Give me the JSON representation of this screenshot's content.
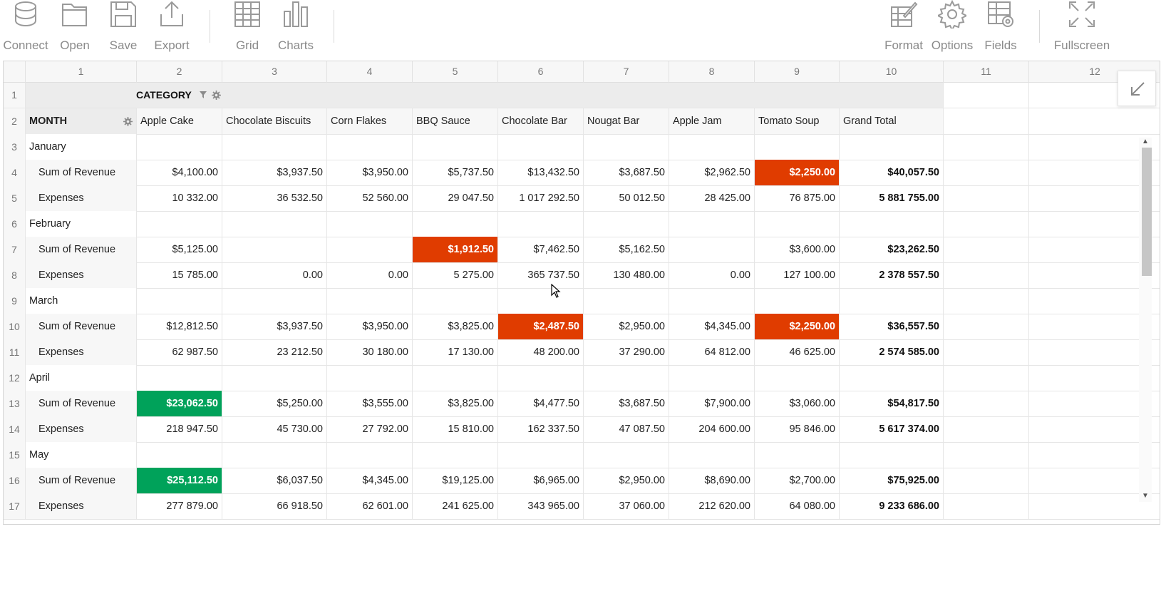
{
  "toolbar": {
    "left": [
      {
        "label": "Connect",
        "icon": "database-icon"
      },
      {
        "label": "Open",
        "icon": "folder-icon"
      },
      {
        "label": "Save",
        "icon": "save-icon"
      },
      {
        "label": "Export",
        "icon": "export-icon"
      },
      {
        "label": "Grid",
        "icon": "grid-icon"
      },
      {
        "label": "Charts",
        "icon": "charts-icon"
      }
    ],
    "right": [
      {
        "label": "Format",
        "icon": "format-icon"
      },
      {
        "label": "Options",
        "icon": "gear-icon"
      },
      {
        "label": "Fields",
        "icon": "fields-icon"
      },
      {
        "label": "Fullscreen",
        "icon": "fullscreen-icon"
      }
    ]
  },
  "grid": {
    "column_numbers": [
      "1",
      "2",
      "3",
      "4",
      "5",
      "6",
      "7",
      "8",
      "9",
      "10",
      "11",
      "12"
    ],
    "category_header": "CATEGORY",
    "month_header": "MONTH",
    "columns": [
      "Apple Cake",
      "Chocolate Biscuits",
      "Corn Flakes",
      "BBQ Sauce",
      "Chocolate Bar",
      "Nougat Bar",
      "Apple Jam",
      "Tomato Soup",
      "Grand Total"
    ],
    "rows": [
      {
        "n": "3",
        "label": "January",
        "type": "month",
        "values": [
          "",
          "",
          "",
          "",
          "",
          "",
          "",
          "",
          ""
        ]
      },
      {
        "n": "4",
        "label": "Sum of Revenue",
        "type": "measure",
        "values": [
          "$4,100.00",
          "$3,937.50",
          "$3,950.00",
          "$5,737.50",
          "$13,432.50",
          "$3,687.50",
          "$2,962.50",
          "$2,250.00",
          "$40,057.50"
        ],
        "highlight": {
          "7": "red"
        }
      },
      {
        "n": "5",
        "label": "Expenses",
        "type": "measure",
        "values": [
          "10 332.00",
          "36 532.50",
          "52 560.00",
          "29 047.50",
          "1 017 292.50",
          "50 012.50",
          "28 425.00",
          "76 875.00",
          "5 881 755.00"
        ]
      },
      {
        "n": "6",
        "label": "February",
        "type": "month",
        "values": [
          "",
          "",
          "",
          "",
          "",
          "",
          "",
          "",
          ""
        ]
      },
      {
        "n": "7",
        "label": "Sum of Revenue",
        "type": "measure",
        "values": [
          "$5,125.00",
          "",
          "",
          "$1,912.50",
          "$7,462.50",
          "$5,162.50",
          "",
          "$3,600.00",
          "$23,262.50"
        ],
        "highlight": {
          "3": "red"
        }
      },
      {
        "n": "8",
        "label": "Expenses",
        "type": "measure",
        "values": [
          "15 785.00",
          "0.00",
          "0.00",
          "5 275.00",
          "365 737.50",
          "130 480.00",
          "0.00",
          "127 100.00",
          "2 378 557.50"
        ]
      },
      {
        "n": "9",
        "label": "March",
        "type": "month",
        "values": [
          "",
          "",
          "",
          "",
          "",
          "",
          "",
          "",
          ""
        ]
      },
      {
        "n": "10",
        "label": "Sum of Revenue",
        "type": "measure",
        "values": [
          "$12,812.50",
          "$3,937.50",
          "$3,950.00",
          "$3,825.00",
          "$2,487.50",
          "$2,950.00",
          "$4,345.00",
          "$2,250.00",
          "$36,557.50"
        ],
        "highlight": {
          "4": "red",
          "7": "red"
        }
      },
      {
        "n": "11",
        "label": "Expenses",
        "type": "measure",
        "values": [
          "62 987.50",
          "23 212.50",
          "30 180.00",
          "17 130.00",
          "48 200.00",
          "37 290.00",
          "64 812.00",
          "46 625.00",
          "2 574 585.00"
        ]
      },
      {
        "n": "12",
        "label": "April",
        "type": "month",
        "values": [
          "",
          "",
          "",
          "",
          "",
          "",
          "",
          "",
          ""
        ]
      },
      {
        "n": "13",
        "label": "Sum of Revenue",
        "type": "measure",
        "values": [
          "$23,062.50",
          "$5,250.00",
          "$3,555.00",
          "$3,825.00",
          "$4,477.50",
          "$3,687.50",
          "$7,900.00",
          "$3,060.00",
          "$54,817.50"
        ],
        "highlight": {
          "0": "green"
        }
      },
      {
        "n": "14",
        "label": "Expenses",
        "type": "measure",
        "values": [
          "218 947.50",
          "45 730.00",
          "27 792.00",
          "15 810.00",
          "162 337.50",
          "47 087.50",
          "204 600.00",
          "95 846.00",
          "5 617 374.00"
        ]
      },
      {
        "n": "15",
        "label": "May",
        "type": "month",
        "values": [
          "",
          "",
          "",
          "",
          "",
          "",
          "",
          "",
          ""
        ]
      },
      {
        "n": "16",
        "label": "Sum of Revenue",
        "type": "measure",
        "values": [
          "$25,112.50",
          "$6,037.50",
          "$4,345.00",
          "$19,125.00",
          "$6,965.00",
          "$2,950.00",
          "$8,690.00",
          "$2,700.00",
          "$75,925.00"
        ],
        "highlight": {
          "0": "green"
        }
      },
      {
        "n": "17",
        "label": "Expenses",
        "type": "measure",
        "values": [
          "277 879.00",
          "66 918.50",
          "62 601.00",
          "241 625.00",
          "343 965.00",
          "37 060.00",
          "212 620.00",
          "64 080.00",
          "9 233 686.00"
        ]
      }
    ]
  },
  "colors": {
    "highlight_red": "#e03c00",
    "highlight_green": "#00a25a",
    "toolbar_text": "#8a8a8a"
  }
}
